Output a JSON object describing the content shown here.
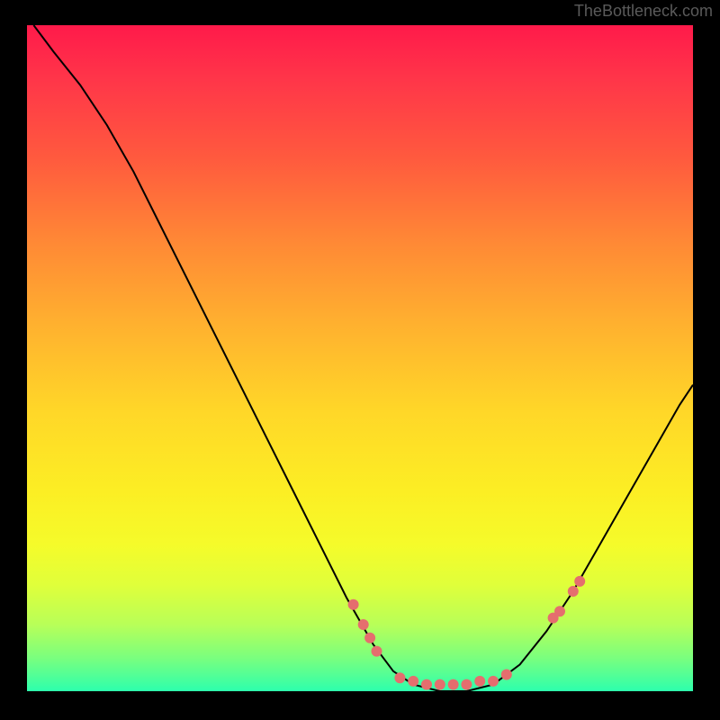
{
  "attribution": "TheBottleneck.com",
  "chart_data": {
    "type": "line",
    "title": "",
    "xlabel": "",
    "ylabel": "",
    "xlim": [
      0,
      100
    ],
    "ylim": [
      0,
      100
    ],
    "curve": {
      "name": "bottleneck-curve",
      "color": "#000000",
      "points": [
        {
          "x": 1,
          "y": 100
        },
        {
          "x": 4,
          "y": 96
        },
        {
          "x": 8,
          "y": 91
        },
        {
          "x": 12,
          "y": 85
        },
        {
          "x": 16,
          "y": 78
        },
        {
          "x": 20,
          "y": 70
        },
        {
          "x": 24,
          "y": 62
        },
        {
          "x": 28,
          "y": 54
        },
        {
          "x": 32,
          "y": 46
        },
        {
          "x": 36,
          "y": 38
        },
        {
          "x": 40,
          "y": 30
        },
        {
          "x": 44,
          "y": 22
        },
        {
          "x": 48,
          "y": 14
        },
        {
          "x": 52,
          "y": 7
        },
        {
          "x": 55,
          "y": 3
        },
        {
          "x": 58,
          "y": 1
        },
        {
          "x": 62,
          "y": 0
        },
        {
          "x": 66,
          "y": 0
        },
        {
          "x": 70,
          "y": 1
        },
        {
          "x": 74,
          "y": 4
        },
        {
          "x": 78,
          "y": 9
        },
        {
          "x": 82,
          "y": 15
        },
        {
          "x": 86,
          "y": 22
        },
        {
          "x": 90,
          "y": 29
        },
        {
          "x": 94,
          "y": 36
        },
        {
          "x": 98,
          "y": 43
        },
        {
          "x": 100,
          "y": 46
        }
      ]
    },
    "scatter": {
      "name": "data-points",
      "color": "#e56e6e",
      "radius": 6,
      "points": [
        {
          "x": 49,
          "y": 13
        },
        {
          "x": 50.5,
          "y": 10
        },
        {
          "x": 51.5,
          "y": 8
        },
        {
          "x": 52.5,
          "y": 6
        },
        {
          "x": 56,
          "y": 2
        },
        {
          "x": 58,
          "y": 1.5
        },
        {
          "x": 60,
          "y": 1
        },
        {
          "x": 62,
          "y": 1
        },
        {
          "x": 64,
          "y": 1
        },
        {
          "x": 66,
          "y": 1
        },
        {
          "x": 68,
          "y": 1.5
        },
        {
          "x": 70,
          "y": 1.5
        },
        {
          "x": 72,
          "y": 2.5
        },
        {
          "x": 79,
          "y": 11
        },
        {
          "x": 80,
          "y": 12
        },
        {
          "x": 82,
          "y": 15
        },
        {
          "x": 83,
          "y": 16.5
        }
      ]
    }
  }
}
